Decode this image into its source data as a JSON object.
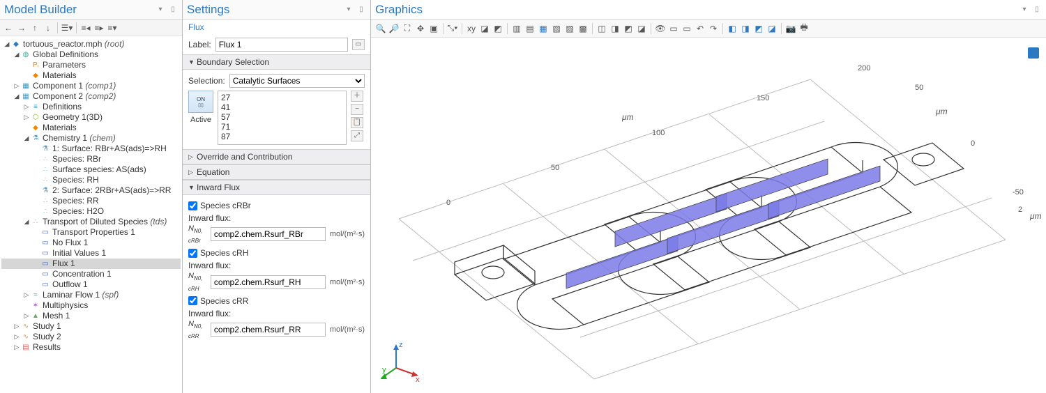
{
  "panels": {
    "modelBuilder": {
      "title": "Model Builder"
    },
    "settings": {
      "title": "Settings",
      "subhead": "Flux"
    },
    "graphics": {
      "title": "Graphics"
    }
  },
  "tree": {
    "root": {
      "label": "tortuous_reactor.mph",
      "suffix": "(root)"
    },
    "globalDefs": "Global Definitions",
    "parameters": "Parameters",
    "gMaterials": "Materials",
    "comp1": {
      "label": "Component 1",
      "suffix": "(comp1)"
    },
    "comp2": {
      "label": "Component 2",
      "suffix": "(comp2)"
    },
    "defs": "Definitions",
    "geom": "Geometry 1(3D)",
    "cMaterials": "Materials",
    "chem": {
      "label": "Chemistry 1",
      "suffix": "(chem)"
    },
    "rxn1": "1: Surface: RBr+AS(ads)=>RH",
    "speciesRBr": "Species: RBr",
    "surfAS": "Surface species: AS(ads)",
    "speciesRH": "Species: RH",
    "rxn2": "2: Surface: 2RBr+AS(ads)=>RR",
    "speciesRR": "Species: RR",
    "speciesH2O": "Species: H2O",
    "tds": {
      "label": "Transport of Diluted Species",
      "suffix": "(tds)"
    },
    "tprops": "Transport Properties 1",
    "noflux": "No Flux 1",
    "initvals": "Initial Values 1",
    "flux1": "Flux 1",
    "conc1": "Concentration 1",
    "outflow1": "Outflow 1",
    "spf": {
      "label": "Laminar Flow 1",
      "suffix": "(spf)"
    },
    "multiph": "Multiphysics",
    "mesh": "Mesh 1",
    "study1": "Study 1",
    "study2": "Study 2",
    "results": "Results"
  },
  "settingsForm": {
    "labelField": {
      "caption": "Label:",
      "value": "Flux 1"
    },
    "boundarySel": {
      "header": "Boundary Selection",
      "caption": "Selection:",
      "selected": "Catalytic Surfaces",
      "activeLabel": "Active",
      "onToggle": "ON",
      "entries": [
        "27",
        "41",
        "57",
        "71",
        "87"
      ]
    },
    "override": "Override and Contribution",
    "equation": "Equation",
    "inwardFlux": {
      "header": "Inward Flux",
      "fluxCaption": "Inward flux:",
      "unit": "mol/(m²·s)",
      "species": [
        {
          "chk": "Species cRBr",
          "var": "N0, cRBr",
          "expr": "comp2.chem.Rsurf_RBr"
        },
        {
          "chk": "Species cRH",
          "var": "N0, cRH",
          "expr": "comp2.chem.Rsurf_RH"
        },
        {
          "chk": "Species cRR",
          "var": "N0, cRR",
          "expr": "comp2.chem.Rsurf_RR"
        }
      ]
    }
  },
  "graphics": {
    "xTicks": [
      "0",
      "50",
      "100",
      "150",
      "200"
    ],
    "yTicks": [
      "50",
      "0",
      "-50"
    ],
    "zTicks": [
      "2"
    ],
    "xUnit": "μm",
    "yUnit": "μm",
    "zUnit": "μm",
    "axes": {
      "x": "x",
      "y": "y",
      "z": "z"
    }
  }
}
